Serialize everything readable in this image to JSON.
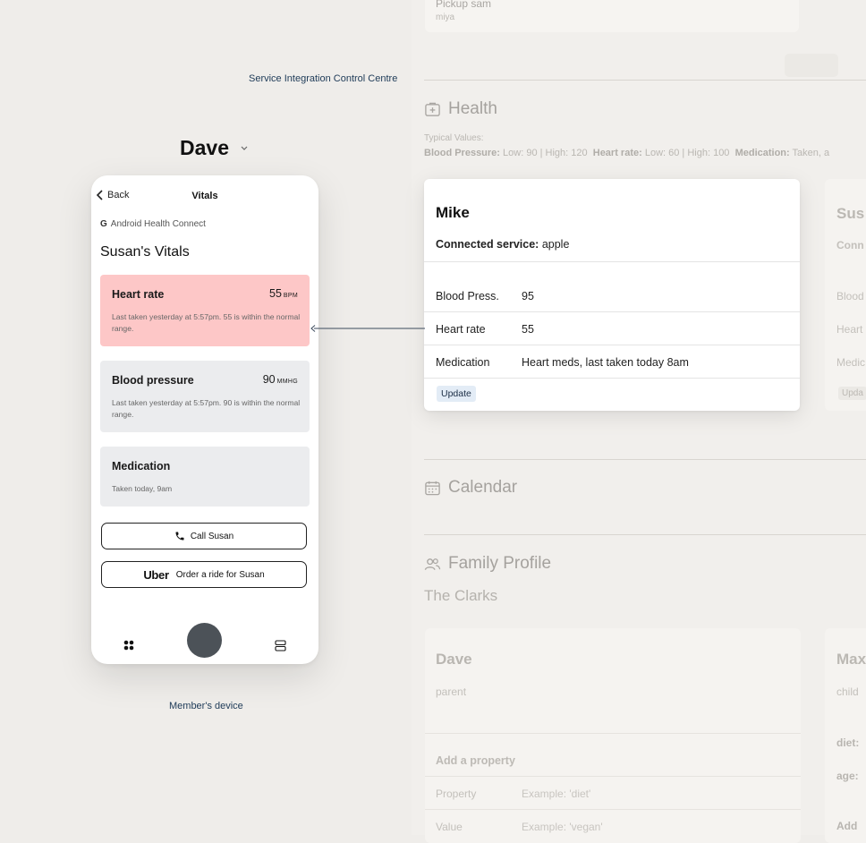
{
  "left": {
    "control_centre_label": "Service Integration Control Centre",
    "member_name": "Dave",
    "member_device_label": "Member's device"
  },
  "phone": {
    "back_label": "Back",
    "title": "Vitals",
    "source": "Android Health Connect",
    "source_logo": "G",
    "heading": "Susan's Vitals",
    "cards": [
      {
        "name": "Heart rate",
        "value": "55",
        "unit": "BPM",
        "note": "Last taken yesterday at 5:57pm. 55 is within the normal range.",
        "status_color": "#fdc7c7"
      },
      {
        "name": "Blood pressure",
        "value": "90",
        "unit": "MMHG",
        "note": "Last taken yesterday at 5:57pm. 90 is within the normal range."
      },
      {
        "name": "Medication",
        "note": "Taken today, 9am"
      }
    ],
    "call_button": "Call Susan",
    "uber_brand": "Uber",
    "ride_button": "Order a ride for Susan"
  },
  "right": {
    "pickup_title": "Pickup sam",
    "pickup_sub": "miya",
    "health_title": "Health",
    "typical_label": "Typical Values:",
    "typical": {
      "bp_label": "Blood Pressure:",
      "bp_value": "Low: 90 | High: 120",
      "hr_label": "Heart rate:",
      "hr_value": "Low: 60 | High: 100",
      "med_label": "Medication:",
      "med_value": "Taken, a"
    },
    "mike": {
      "name": "Mike",
      "service_label": "Connected service:",
      "service_value": "apple",
      "rows": [
        {
          "label": "Blood Press.",
          "value": "95"
        },
        {
          "label": "Heart rate",
          "value": "55"
        },
        {
          "label": "Medication",
          "value": "Heart meds, last taken today 8am"
        }
      ],
      "update_button": "Update"
    },
    "susan_partial": {
      "name": "Sus",
      "conn": "Conn",
      "rows": [
        "Blood",
        "Heart",
        "Medic"
      ],
      "update": "Upda"
    },
    "calendar_title": "Calendar",
    "family_title": "Family Profile",
    "family_name": "The Clarks",
    "dave": {
      "name": "Dave",
      "role": "parent",
      "add_property": "Add a property",
      "property_label": "Property",
      "property_placeholder": "Example: 'diet'",
      "value_label": "Value",
      "value_placeholder": "Example: 'vegan'"
    },
    "max_partial": {
      "name": "Max",
      "role": "child",
      "props": [
        "diet:",
        "age:"
      ],
      "add": "Add"
    }
  }
}
